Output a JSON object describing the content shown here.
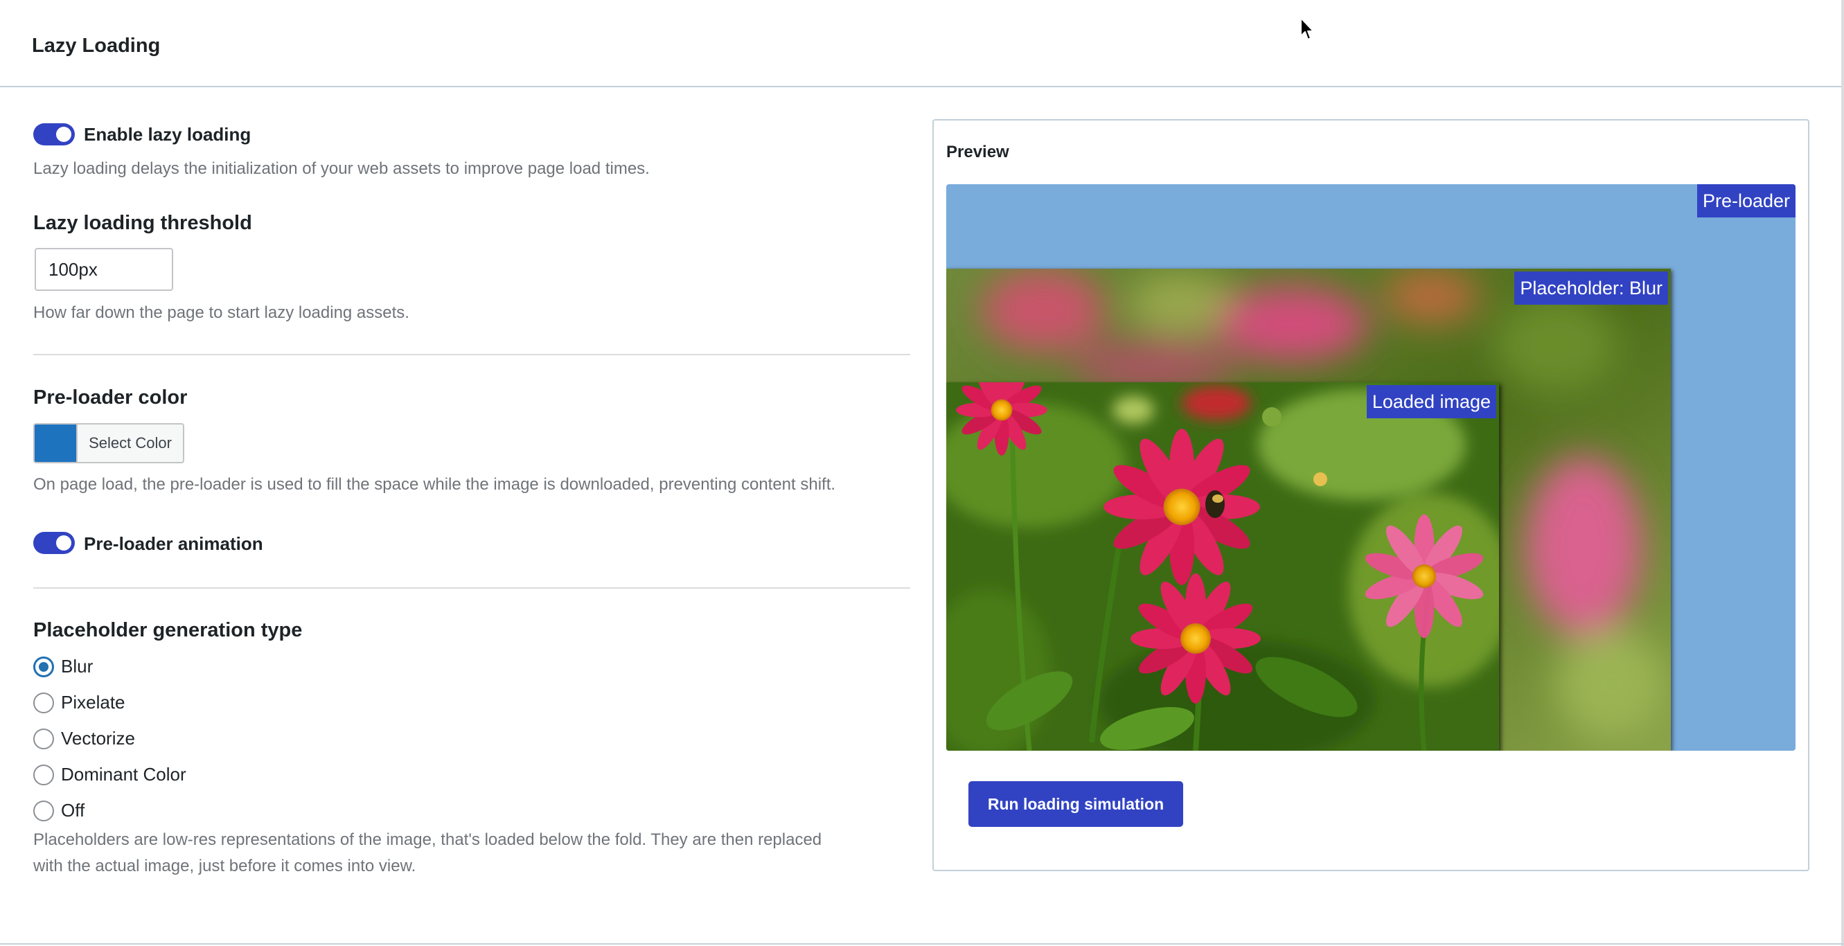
{
  "header": {
    "title": "Lazy Loading"
  },
  "lazy_loading": {
    "enabled": true,
    "label": "Enable lazy loading",
    "description": "Lazy loading delays the initialization of your web assets to improve page load times."
  },
  "threshold": {
    "heading": "Lazy loading threshold",
    "value": "100px",
    "help": "How far down the page to start lazy loading assets."
  },
  "preloader_color": {
    "heading": "Pre-loader color",
    "swatch_color": "#1e73be",
    "button_label": "Select Color",
    "help": "On page load, the pre-loader is used to fill the space while the image is downloaded, preventing content shift."
  },
  "preloader_animation": {
    "enabled": true,
    "label": "Pre-loader animation"
  },
  "placeholder": {
    "heading": "Placeholder generation type",
    "options": [
      {
        "label": "Blur",
        "checked": true
      },
      {
        "label": "Pixelate",
        "checked": false
      },
      {
        "label": "Vectorize",
        "checked": false
      },
      {
        "label": "Dominant Color",
        "checked": false
      },
      {
        "label": "Off",
        "checked": false
      }
    ],
    "help_line1": "Placeholders are low-res representations of the image, that's loaded below the fold. They are then replaced",
    "help_line2": "with the actual image, just before it comes into view."
  },
  "preview": {
    "title": "Preview",
    "preloader_tag": "Pre-loader",
    "placeholder_tag": "Placeholder: Blur",
    "loaded_tag": "Loaded image",
    "run_button": "Run loading simulation"
  },
  "colors": {
    "accent": "#3143c3",
    "stage": "#79abdb",
    "radio_checked": "#2271b1"
  },
  "icons": {
    "cursor": "mouse-pointer-icon",
    "image": "flower-photo"
  }
}
